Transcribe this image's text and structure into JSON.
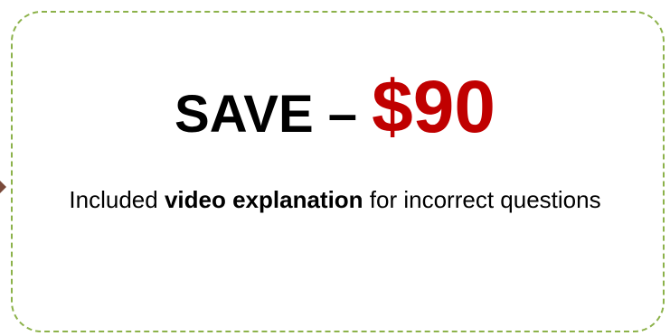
{
  "coupon": {
    "headline_prefix": "SAVE – ",
    "headline_price": "$90",
    "description_before": "Included ",
    "description_bold": "video explanation",
    "description_after": " for incorrect questions",
    "colors": {
      "border": "#8cb24a",
      "price": "#c00000",
      "text": "#000000"
    }
  }
}
